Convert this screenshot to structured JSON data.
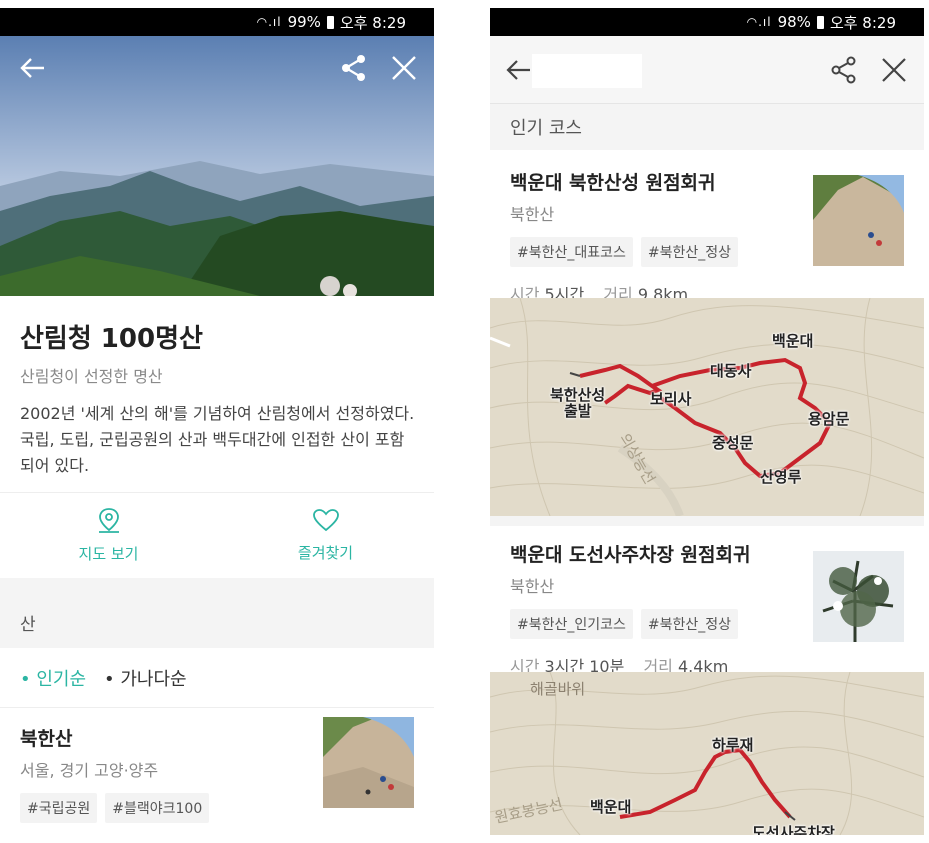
{
  "left": {
    "status": {
      "battery": "99%",
      "time": "오후 8:29"
    },
    "title": "산림청 100명산",
    "subtitle": "산림청이 선정한 명산",
    "description": "2002년 '세계 산의 해'를 기념하여 산림청에서 선정하였다. 국립, 도립, 군립공원의 산과 백두대간에 인접한 산이 포함되어 있다.",
    "actions": {
      "map_label": "지도 보기",
      "favorite_label": "즐겨찾기"
    },
    "section_header": "산",
    "sort": {
      "popular": "인기순",
      "alpha": "가나다순"
    },
    "item": {
      "name": "북한산",
      "location": "서울, 경기 고양·양주",
      "tags": [
        "#국립공원",
        "#블랙야크100"
      ]
    }
  },
  "right": {
    "status": {
      "battery": "98%",
      "time": "오후 8:29"
    },
    "section_header": "인기 코스",
    "courses": [
      {
        "title": "백운대 북한산성 원점회귀",
        "mountain": "북한산",
        "tags": [
          "#북한산_대표코스",
          "#북한산_정상"
        ],
        "time_label": "시간",
        "time": "5시간",
        "dist_label": "거리",
        "dist": "9.8km"
      },
      {
        "title": "백운대 도선사주차장 원점회귀",
        "mountain": "북한산",
        "tags": [
          "#북한산_인기코스",
          "#북한산_정상"
        ],
        "time_label": "시간",
        "time": "3시간 10분",
        "dist_label": "거리",
        "dist": "4.4km"
      }
    ],
    "map1_labels": {
      "start_a": "북한산성",
      "start_b": "출발",
      "bori": "보리사",
      "daedong": "대동사",
      "baegun": "백운대",
      "yongam": "용암문",
      "jungseong": "중성문",
      "sanyeong": "산영루",
      "road": "의상능선"
    },
    "map2_labels": {
      "haegol": "해골바위",
      "haru": "하루재",
      "baegun": "백운대",
      "doseon": "도선사주차장",
      "road": "원효봉능선"
    }
  },
  "colors": {
    "accent": "#2bb5a3",
    "route": "#c8232c"
  }
}
